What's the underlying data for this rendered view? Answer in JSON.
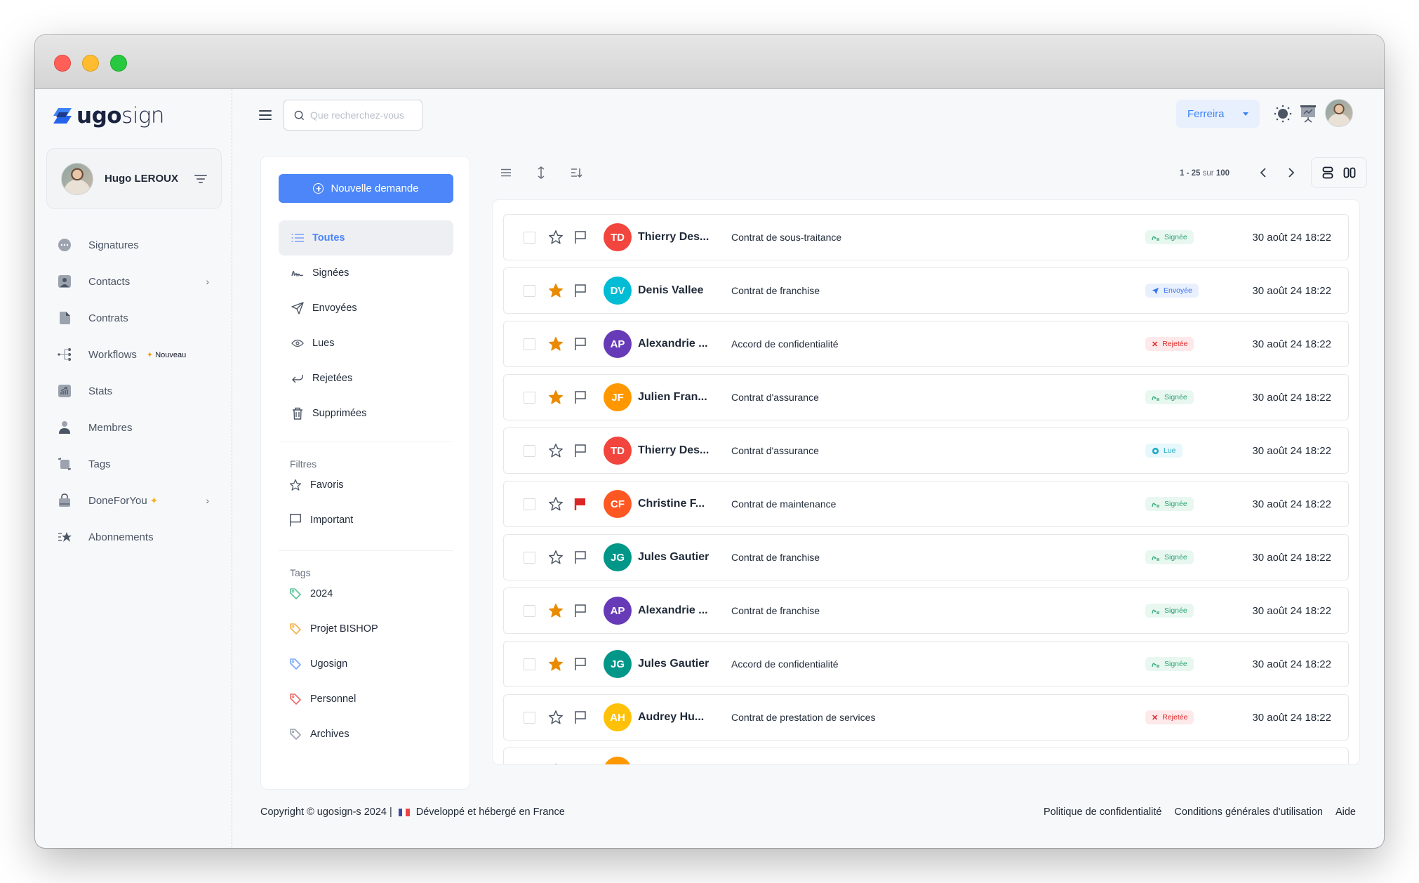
{
  "app": {
    "brand": {
      "bold": "ugo",
      "light": "sign"
    },
    "colors": {
      "accent": "#4c86f9",
      "star": "#ea8a00",
      "flag_important": "#dc2626"
    }
  },
  "user": {
    "name": "Hugo LEROUX"
  },
  "sidebar": {
    "items": [
      {
        "label": "Signatures",
        "icon": "signature-icon"
      },
      {
        "label": "Contacts",
        "icon": "contact-card-icon",
        "chevron": true
      },
      {
        "label": "Contrats",
        "icon": "document-icon"
      },
      {
        "label": "Workflows",
        "icon": "workflow-icon",
        "badge": "Nouveau"
      },
      {
        "label": "Stats",
        "icon": "chart-icon"
      },
      {
        "label": "Membres",
        "icon": "person-icon"
      },
      {
        "label": "Tags",
        "icon": "tag-crop-icon"
      },
      {
        "label": "DoneForYou",
        "icon": "bag-icon",
        "sparkle": "✨",
        "chevron": true
      },
      {
        "label": "Abonnements",
        "icon": "star-list-icon"
      }
    ]
  },
  "topbar": {
    "search_placeholder": "Que recherchez-vous",
    "org_select": "Ferreira"
  },
  "folders": {
    "new_button": "Nouvelle demande",
    "items": [
      {
        "label": "Toutes",
        "active": true
      },
      {
        "label": "Signées"
      },
      {
        "label": "Envoyées"
      },
      {
        "label": "Lues"
      },
      {
        "label": "Rejetées"
      },
      {
        "label": "Supprimées"
      }
    ],
    "filters_title": "Filtres",
    "filters": [
      {
        "label": "Favoris"
      },
      {
        "label": "Important"
      }
    ],
    "tags_title": "Tags",
    "tags": [
      {
        "label": "2024",
        "color": "#5cc39a"
      },
      {
        "label": "Projet BISHOP",
        "color": "#f4b14a"
      },
      {
        "label": "Ugosign",
        "color": "#7aa5f6"
      },
      {
        "label": "Personnel",
        "color": "#ec6a6a"
      },
      {
        "label": "Archives",
        "color": "#9ca3af"
      }
    ]
  },
  "pagination": {
    "range": "1 - 25",
    "sep": "sur",
    "total": "100"
  },
  "requests": [
    {
      "initials": "TD",
      "name": "Thierry Des...",
      "color": "#f1453d",
      "doc": "Contrat de sous-traitance",
      "status": "Signée",
      "type": "signed",
      "starred": false,
      "flagged": false,
      "date": "30 août 24 18:22"
    },
    {
      "initials": "DV",
      "name": "Denis Vallee",
      "color": "#00bcd4",
      "doc": "Contrat de franchise",
      "status": "Envoyée",
      "type": "sent",
      "starred": true,
      "flagged": false,
      "date": "30 août 24 18:22"
    },
    {
      "initials": "AP",
      "name": "Alexandrie ...",
      "color": "#673ab7",
      "doc": "Accord de confidentialité",
      "status": "Rejetée",
      "type": "rejected",
      "starred": true,
      "flagged": false,
      "date": "30 août 24 18:22"
    },
    {
      "initials": "JF",
      "name": "Julien Fran...",
      "color": "#ff9800",
      "doc": "Contrat d'assurance",
      "status": "Signée",
      "type": "signed",
      "starred": true,
      "flagged": false,
      "date": "30 août 24 18:22"
    },
    {
      "initials": "TD",
      "name": "Thierry Des...",
      "color": "#f1453d",
      "doc": "Contrat d'assurance",
      "status": "Lue",
      "type": "read",
      "starred": false,
      "flagged": false,
      "date": "30 août 24 18:22"
    },
    {
      "initials": "CF",
      "name": "Christine F...",
      "color": "#ff5722",
      "doc": "Contrat de maintenance",
      "status": "Signée",
      "type": "signed",
      "starred": false,
      "flagged": true,
      "date": "30 août 24 18:22"
    },
    {
      "initials": "JG",
      "name": "Jules Gautier",
      "color": "#009688",
      "doc": "Contrat de franchise",
      "status": "Signée",
      "type": "signed",
      "starred": false,
      "flagged": false,
      "date": "30 août 24 18:22"
    },
    {
      "initials": "AP",
      "name": "Alexandrie ...",
      "color": "#673ab7",
      "doc": "Contrat de franchise",
      "status": "Signée",
      "type": "signed",
      "starred": true,
      "flagged": false,
      "date": "30 août 24 18:22"
    },
    {
      "initials": "JG",
      "name": "Jules Gautier",
      "color": "#009688",
      "doc": "Accord de confidentialité",
      "status": "Signée",
      "type": "signed",
      "starred": true,
      "flagged": false,
      "date": "30 août 24 18:22"
    },
    {
      "initials": "AH",
      "name": "Audrey Hu...",
      "color": "#ffc107",
      "doc": "Contrat de prestation de services",
      "status": "Rejetée",
      "type": "rejected",
      "starred": false,
      "flagged": false,
      "date": "30 août 24 18:22"
    },
    {
      "initials": "",
      "name": "",
      "color": "#ff9800",
      "doc": "",
      "status": "",
      "type": "",
      "starred": false,
      "flagged": false,
      "date": ""
    }
  ],
  "footer": {
    "copyright": "Copyright © ugosign-s 2024 |",
    "made_in": "Développé et hébergé en France",
    "links": [
      "Politique de confidentialité",
      "Conditions générales d'utilisation",
      "Aide"
    ]
  }
}
